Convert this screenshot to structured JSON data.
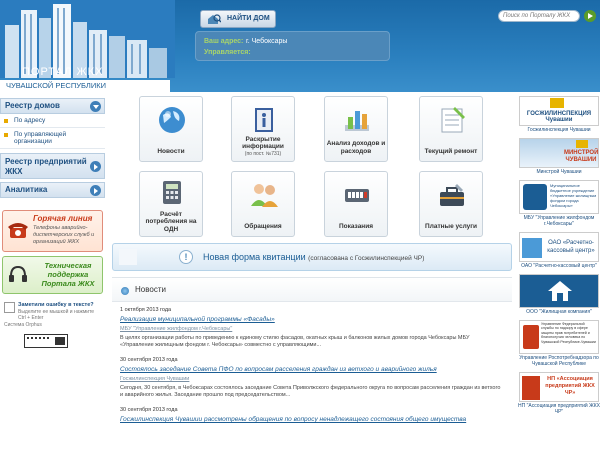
{
  "header": {
    "logo_title": "ПОРТАЛ ЖКХ",
    "logo_subtitle": "ЧУВАШСКОЙ РЕСПУБЛИКИ",
    "find_button": "НАЙТИ ДОМ",
    "address_label": "Ваш адрес:",
    "address_value": "г. Чебоксары",
    "manager_label": "Управляется:",
    "manager_value": "",
    "search_placeholder": "Поиск по Порталу ЖКХ"
  },
  "sidebar": {
    "registry_houses": "Реестр домов",
    "by_address": "По адресу",
    "by_org": "По управляющей организации",
    "registry_companies": "Реестр предприятий ЖКХ",
    "analytics": "Аналитика",
    "hotline_title": "Горячая линия",
    "hotline_desc": "Телефоны аварийно-диспетчерских служб и организаций ЖКХ",
    "support_title": "Техническая поддержка Портала ЖКХ",
    "typo_title": "Заметили ошибку в тексте?",
    "typo_desc": "Выделите ее мышкой и нажмите Ctrl + Enter",
    "orphus": "Система Orphus"
  },
  "tiles": [
    {
      "label": "Новости",
      "sub": ""
    },
    {
      "label": "Раскрытие информации",
      "sub": "(по пост. №731)"
    },
    {
      "label": "Анализ доходов и расходов",
      "sub": ""
    },
    {
      "label": "Текущий ремонт",
      "sub": ""
    },
    {
      "label": "Расчёт потребления на ОДН",
      "sub": ""
    },
    {
      "label": "Обращения",
      "sub": ""
    },
    {
      "label": "Показания",
      "sub": ""
    },
    {
      "label": "Платные услуги",
      "sub": ""
    }
  ],
  "banner": {
    "title": "Новая форма квитанции",
    "subtitle": "(согласована с Госжилинспекцией ЧР)"
  },
  "news": {
    "heading": "Новости",
    "items": [
      {
        "date": "1 октября 2013 года",
        "title": "Реализация муниципальной программы «Фасады»",
        "source": "МБУ \"Управление жилфондом г.Чебоксары\"",
        "body": "В целях организации работы по приведению к единому стилю фасадов, окатных крыш и балконов жилых домов города Чебоксары МБУ «Управление жилищным фондом г. Чебоксары» совместно с управляющими..."
      },
      {
        "date": "30 сентября 2013 года",
        "title": "Состоялось заседание Совета ПФО по вопросам расселения граждан из ветхого и аварийного жилья",
        "source": "Госжилинспекция Чувашии",
        "body": "Сегодня, 30 сентября, в Чебоксарах состоялось заседание Совета Приволжского федерального округа по вопросам расселения граждан из ветхого и аварийного жилья. Заседание прошло под председательством..."
      },
      {
        "date": "30 сентября 2013 года",
        "title": "Госжилинспекция Чувашии рассмотрены обращения по вопросу ненадлежащего состояния общего имущества",
        "source": "",
        "body": ""
      }
    ]
  },
  "right_ads": [
    {
      "img_text": "ГОСЖИЛИНСПЕКЦИЯ Чувашии",
      "caption": "Госжилинспекция Чувашии"
    },
    {
      "img_text": "МИНСТРОЙ ЧУВАШИИ",
      "caption": "Минстрой Чувашии"
    },
    {
      "img_text": "Муниципальное бюджетное учреждение «Управление жилищным фондом города Чебоксары»",
      "caption": "МБУ \"Управление жилфондом г.Чебоксары\""
    },
    {
      "img_text": "ОАО «Расчетно-кассовый центр»",
      "caption": "ОАО \"Расчетно-кассовый центр\""
    },
    {
      "img_text": "",
      "caption": "ООО \"Жилищная компания\""
    },
    {
      "img_text": "Управление Федеральной службы по надзору в сфере защиты прав потребителей и благополучия человека по Чувашской Республике-Чувашии",
      "caption": "Управление Роспотребнадзора по Чувашской Республике"
    },
    {
      "img_text": "НП «Ассоциация предприятий ЖКХ ЧР»",
      "caption": "НП \"Ассоциация предприятий ЖКХ ЧР\""
    }
  ]
}
